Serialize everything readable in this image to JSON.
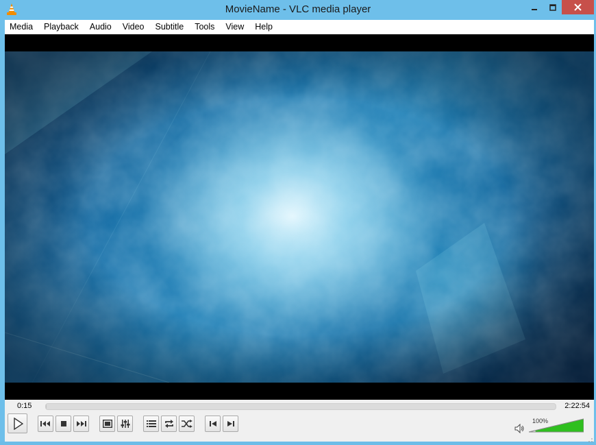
{
  "window": {
    "title": "MovieName - VLC media player",
    "accent_color": "#6ebfea",
    "close_color": "#c7504a",
    "icons": {
      "app": "vlc-cone-icon",
      "minimize": "minimize-icon",
      "maximize": "maximize-icon",
      "close": "close-icon"
    }
  },
  "menu": {
    "items": [
      "Media",
      "Playback",
      "Audio",
      "Video",
      "Subtitle",
      "Tools",
      "View",
      "Help"
    ]
  },
  "playback": {
    "elapsed": "0:15",
    "total": "2:22:54",
    "progress_percent": 0.2
  },
  "controls": {
    "buttons": [
      "play-icon",
      "previous-icon",
      "stop-icon",
      "next-icon",
      "fullscreen-icon",
      "extended-settings-icon",
      "playlist-icon",
      "loop-icon",
      "shuffle-icon",
      "frame-back-icon",
      "frame-next-icon"
    ]
  },
  "volume": {
    "label": "100%",
    "level_percent": 100,
    "fill_color": "#2fbf1f",
    "icon": "speaker-icon"
  }
}
